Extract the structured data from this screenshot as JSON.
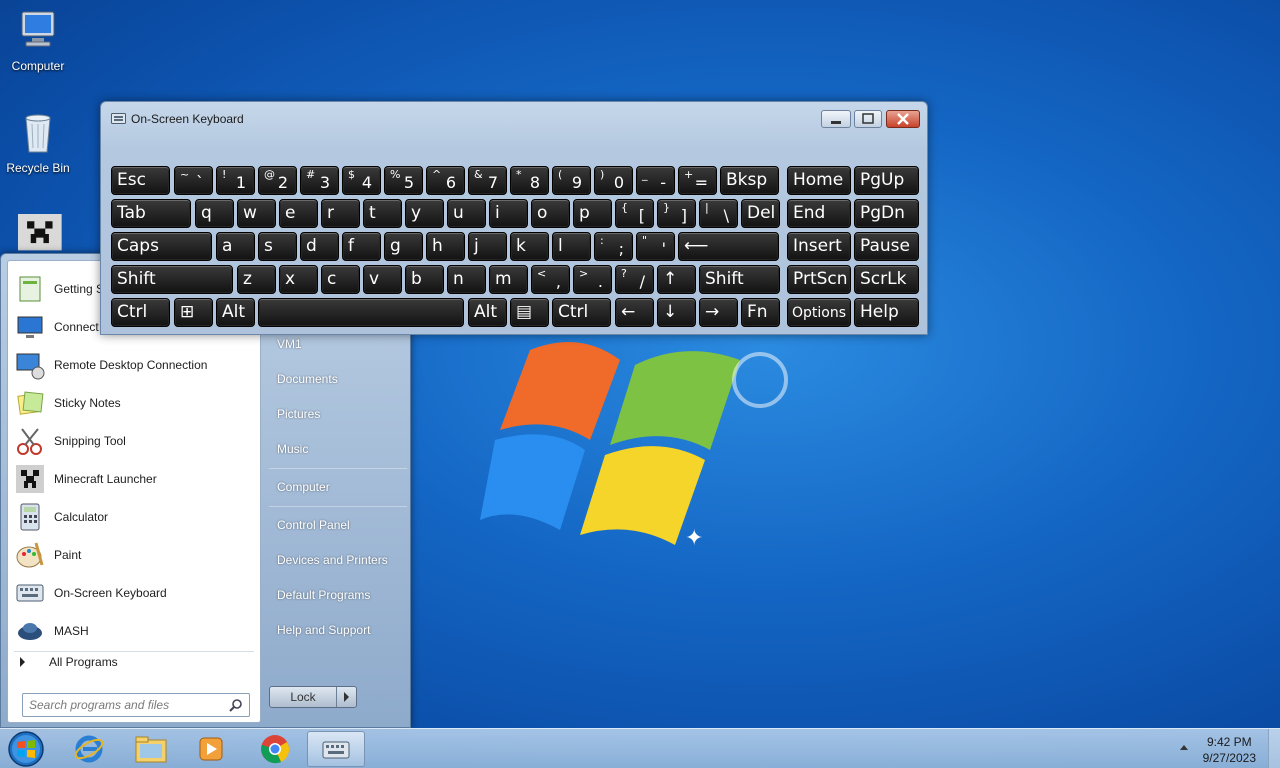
{
  "desktop": {
    "icons": [
      {
        "label": "Computer"
      },
      {
        "label": "Recycle Bin"
      }
    ]
  },
  "osk": {
    "title": "On-Screen Keyboard",
    "rows": [
      [
        {
          "main": "Esc"
        },
        {
          "shift": "~",
          "lower": "`"
        },
        {
          "shift": "!",
          "lower": "1"
        },
        {
          "shift": "@",
          "lower": "2"
        },
        {
          "shift": "#",
          "lower": "3"
        },
        {
          "shift": "$",
          "lower": "4"
        },
        {
          "shift": "%",
          "lower": "5"
        },
        {
          "shift": "^",
          "lower": "6"
        },
        {
          "shift": "&",
          "lower": "7"
        },
        {
          "shift": "*",
          "lower": "8"
        },
        {
          "shift": "(",
          "lower": "9"
        },
        {
          "shift": ")",
          "lower": "0"
        },
        {
          "shift": "_",
          "lower": "-"
        },
        {
          "shift": "+",
          "lower": "="
        },
        {
          "main": "Bksp"
        },
        {
          "main": "Home"
        },
        {
          "main": "PgUp"
        }
      ],
      [
        {
          "main": "Tab"
        },
        {
          "main": "q"
        },
        {
          "main": "w"
        },
        {
          "main": "e"
        },
        {
          "main": "r"
        },
        {
          "main": "t"
        },
        {
          "main": "y"
        },
        {
          "main": "u"
        },
        {
          "main": "i"
        },
        {
          "main": "o"
        },
        {
          "main": "p"
        },
        {
          "shift": "{",
          "lower": "["
        },
        {
          "shift": "}",
          "lower": "]"
        },
        {
          "shift": "|",
          "lower": "\\"
        },
        {
          "main": "Del"
        },
        {
          "main": "End"
        },
        {
          "main": "PgDn"
        }
      ],
      [
        {
          "main": "Caps"
        },
        {
          "main": "a"
        },
        {
          "main": "s"
        },
        {
          "main": "d"
        },
        {
          "main": "f"
        },
        {
          "main": "g"
        },
        {
          "main": "h"
        },
        {
          "main": "j"
        },
        {
          "main": "k"
        },
        {
          "main": "l"
        },
        {
          "shift": ":",
          "lower": ";"
        },
        {
          "shift": "\"",
          "lower": "'"
        },
        {
          "main": "⟵"
        },
        {
          "main": "Insert"
        },
        {
          "main": "Pause"
        }
      ],
      [
        {
          "main": "Shift"
        },
        {
          "main": "z"
        },
        {
          "main": "x"
        },
        {
          "main": "c"
        },
        {
          "main": "v"
        },
        {
          "main": "b"
        },
        {
          "main": "n"
        },
        {
          "main": "m"
        },
        {
          "shift": "<",
          "lower": ","
        },
        {
          "shift": ">",
          "lower": "."
        },
        {
          "shift": "?",
          "lower": "/"
        },
        {
          "main": "↑"
        },
        {
          "main": "Shift"
        },
        {
          "main": "PrtScn"
        },
        {
          "main": "ScrLk"
        }
      ],
      [
        {
          "main": "Ctrl"
        },
        {
          "main": "⊞"
        },
        {
          "main": "Alt"
        },
        {
          "main": ""
        },
        {
          "main": "Alt"
        },
        {
          "main": "▤"
        },
        {
          "main": "Ctrl"
        },
        {
          "main": "←"
        },
        {
          "main": "↓"
        },
        {
          "main": "→"
        },
        {
          "main": "Fn"
        },
        {
          "small": "Options"
        },
        {
          "main": "Help"
        }
      ]
    ]
  },
  "start_menu": {
    "programs": [
      {
        "label": "Getting S"
      },
      {
        "label": "Connect t"
      },
      {
        "label": "Remote Desktop Connection"
      },
      {
        "label": "Sticky Notes"
      },
      {
        "label": "Snipping Tool"
      },
      {
        "label": "Minecraft Launcher"
      },
      {
        "label": "Calculator"
      },
      {
        "label": "Paint"
      },
      {
        "label": "On-Screen Keyboard"
      },
      {
        "label": "MASH"
      }
    ],
    "all_programs": "All Programs",
    "search_placeholder": "Search programs and files",
    "right": [
      {
        "label": "VM1"
      },
      {
        "label": "Documents"
      },
      {
        "label": "Pictures"
      },
      {
        "label": "Music"
      },
      {
        "label": "Computer"
      },
      {
        "label": "Control Panel"
      },
      {
        "label": "Devices and Printers"
      },
      {
        "label": "Default Programs"
      },
      {
        "label": "Help and Support"
      }
    ],
    "lock_label": "Lock"
  },
  "taskbar": {
    "time": "9:42 PM",
    "date": "9/27/2023"
  }
}
